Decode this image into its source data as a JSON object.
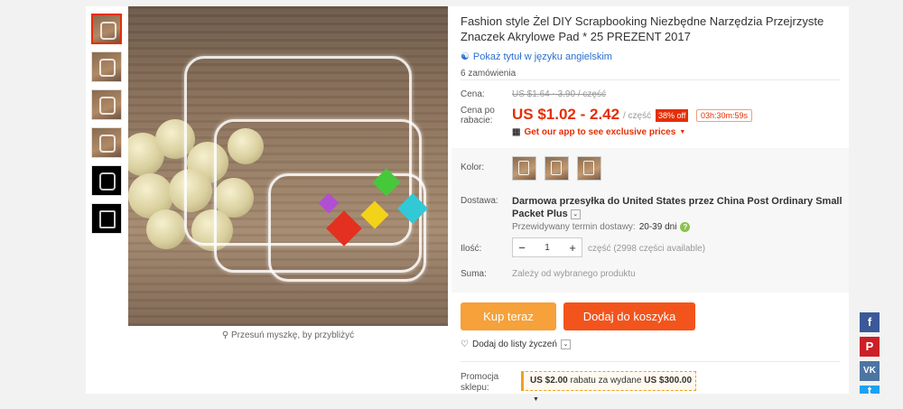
{
  "product": {
    "title": "Fashion style Żel DIY Scrapbooking Niezbędne Narzędzia Przejrzyste Znaczek Akrylowe Pad * 25 PREZENT 2017",
    "translate_link": "Pokaż tytuł w języku angielskim",
    "orders": "6 zamówienia",
    "zoom_hint": "Przesuń myszkę, by przybliżyć"
  },
  "price": {
    "label_price": "Cena:",
    "old_price": "US $1.64 - 3.90 / część",
    "label_discount": "Cena po rabacie:",
    "current": "US $1.02 - 2.42",
    "per_piece": "/ część",
    "discount_badge": "38% off",
    "timer": "03h:30m:59s",
    "app_promo": "Get our app to see exclusive prices"
  },
  "options": {
    "label_color": "Kolor:",
    "label_delivery": "Dostawa:",
    "shipping": "Darmowa przesyłka do United States przez China Post Ordinary Small Packet Plus",
    "delivery_label": "Przewidywany termin dostawy:",
    "delivery_days": "20-39 dni",
    "label_qty": "Ilość:",
    "qty_value": "1",
    "stock": "część (2998 części available)",
    "label_total": "Suma:",
    "total_value": "Zależy od wybranego produktu"
  },
  "actions": {
    "buy_now": "Kup teraz",
    "add_to_cart": "Dodaj do koszyka",
    "wishlist": "Dodaj do listy życzeń"
  },
  "promo": {
    "label": "Promocja sklepu:",
    "text_amount": "US $2.00",
    "text_mid": "rabatu za wydane",
    "text_threshold": "US $300.00"
  },
  "social": {
    "facebook": "f",
    "pinterest": "P",
    "vk": "VK",
    "twitter": "t"
  },
  "colors": {
    "accent": "#e62e04",
    "buy": "#f6a13a",
    "cart": "#f2541c",
    "link": "#2a6fcf"
  }
}
